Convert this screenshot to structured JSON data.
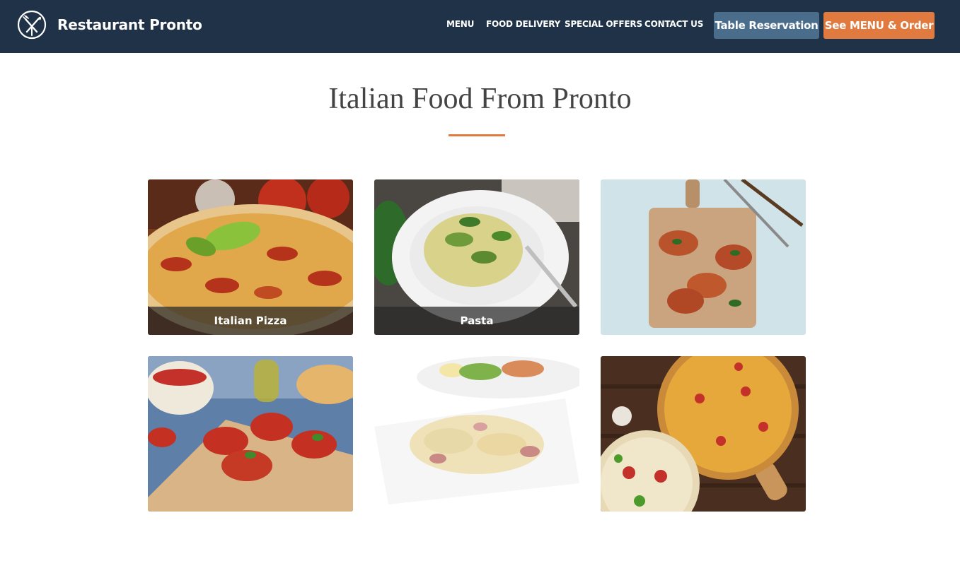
{
  "header": {
    "brand": "Restaurant Pronto",
    "logo_icon": "fork-and-knife-icon",
    "nav": [
      "MENU",
      "FOOD DELIVERY",
      "SPECIAL OFFERS",
      "CONTACT US"
    ],
    "reserve_button": "Table Reservation",
    "order_button": "See MENU & Order"
  },
  "colors": {
    "header_bg": "#1f3247",
    "accent": "#e07a3f",
    "secondary_button": "#4a6d8c"
  },
  "main": {
    "title": "Italian Food From Pronto",
    "tiles": [
      {
        "caption": "Italian Pizza"
      },
      {
        "caption": "Pasta"
      },
      {
        "caption": ""
      },
      {
        "caption": ""
      },
      {
        "caption": ""
      },
      {
        "caption": ""
      }
    ]
  }
}
